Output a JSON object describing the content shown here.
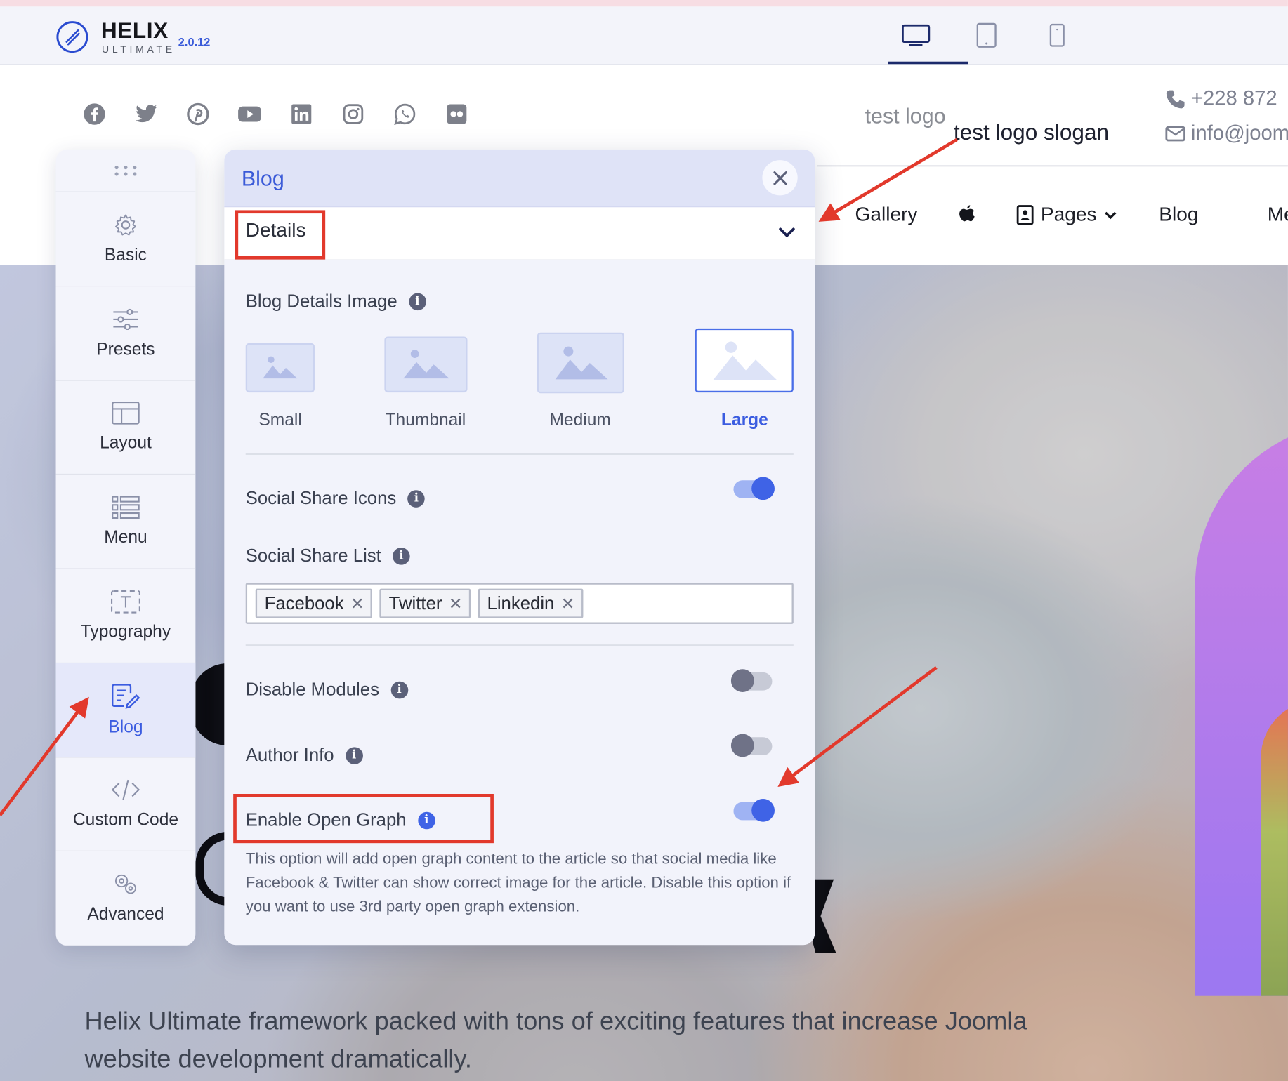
{
  "editor": {
    "brand": "HELIX",
    "brand_sub": "ULTIMATE",
    "version": "2.0.12",
    "devices": [
      {
        "name": "desktop",
        "active": true
      },
      {
        "name": "tablet",
        "active": false
      },
      {
        "name": "mobile",
        "active": false
      }
    ]
  },
  "site": {
    "socials": [
      "facebook-icon",
      "twitter-icon",
      "pinterest-icon",
      "youtube-icon",
      "linkedin-icon",
      "instagram-icon",
      "whatsapp-icon",
      "flickr-icon"
    ],
    "logo_text": "test logo",
    "slogan": "test logo slogan",
    "phone": "+228 872",
    "email": "info@joom",
    "nav": {
      "gallery": "Gallery",
      "pages": "Pages",
      "blog": "Blog",
      "more": "Me"
    },
    "hero_text": "Helix Ultimate framework packed with tons of exciting features that increase Joomla website development dramatically."
  },
  "sidebar": {
    "items": [
      {
        "label": "Basic",
        "icon": "gear-icon",
        "active": false
      },
      {
        "label": "Presets",
        "icon": "sliders-icon",
        "active": false
      },
      {
        "label": "Layout",
        "icon": "layout-icon",
        "active": false
      },
      {
        "label": "Menu",
        "icon": "menu-list-icon",
        "active": false
      },
      {
        "label": "Typography",
        "icon": "typography-icon",
        "active": false
      },
      {
        "label": "Blog",
        "icon": "blog-edit-icon",
        "active": true
      },
      {
        "label": "Custom Code",
        "icon": "code-icon",
        "active": false
      },
      {
        "label": "Advanced",
        "icon": "advanced-gears-icon",
        "active": false
      }
    ]
  },
  "panel": {
    "title": "Blog",
    "section": "Details",
    "blog_details_image": {
      "label": "Blog Details Image",
      "options": [
        "Small",
        "Thumbnail",
        "Medium",
        "Large"
      ],
      "selected": "Large"
    },
    "social_share_icons": {
      "label": "Social Share Icons",
      "enabled": true
    },
    "social_share_list": {
      "label": "Social Share List",
      "tags": [
        "Facebook",
        "Twitter",
        "Linkedin"
      ]
    },
    "disable_modules": {
      "label": "Disable Modules",
      "enabled": false
    },
    "author_info": {
      "label": "Author Info",
      "enabled": false
    },
    "open_graph": {
      "label": "Enable Open Graph",
      "enabled": true,
      "help": "This option will add open graph content to the article so that social media like Facebook & Twitter can show correct image for the article. Disable this option if you want to use 3rd party open graph extension."
    }
  },
  "colors": {
    "accent": "#3f63e6",
    "annotation_red": "#e2392c",
    "panel_bg": "#f2f3fb"
  }
}
